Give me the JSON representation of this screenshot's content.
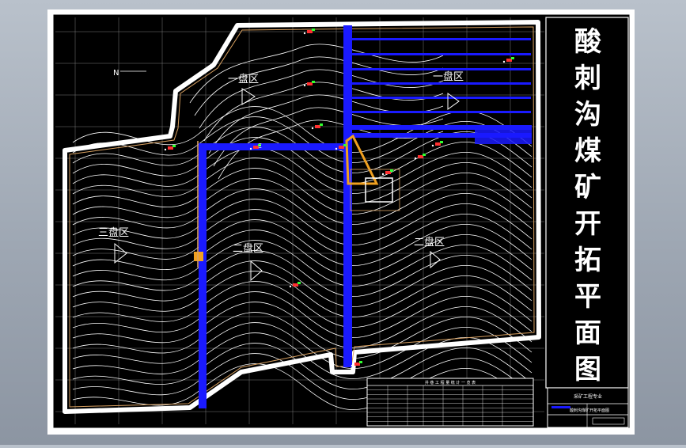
{
  "drawing": {
    "title_chars": [
      "酸",
      "刺",
      "沟",
      "煤",
      "矿",
      "开",
      "拓",
      "平",
      "面",
      "图"
    ],
    "zone_labels": [
      "一盘区",
      "一盘区",
      "三盘区",
      "二盘区",
      "二盘区"
    ],
    "north_mark": "N",
    "shaft_mark": "Ξ",
    "table_heading": "井 巷 工 程 量 统 计 一 览 表",
    "table_rows": 9,
    "titleblock_line1": "采矿工程专业",
    "titleblock_line2": "酸刺沟煤矿开拓平面图"
  },
  "colors": {
    "canvas": "#000000",
    "frame": "#ffffff",
    "roadway": "#1a1aff",
    "shaft": "#f0a020",
    "boundary": "#d8a060",
    "contour": "#ffffff",
    "marker_red": "#ff3030",
    "marker_green": "#30ff30"
  }
}
